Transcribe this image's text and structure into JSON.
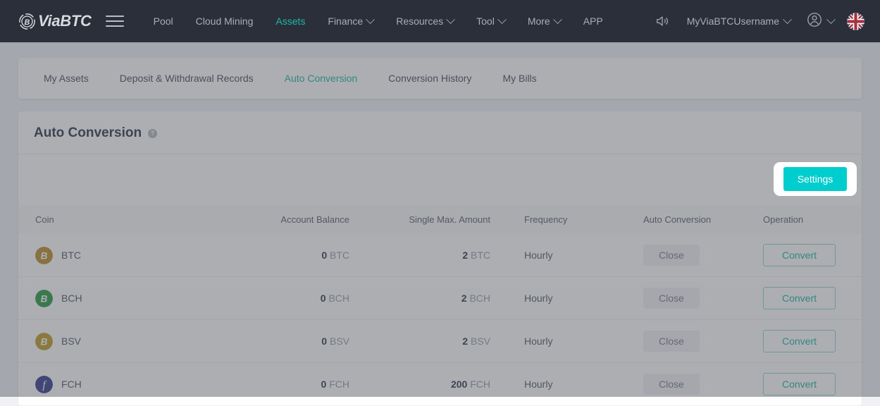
{
  "header": {
    "brand": "ViaBTC",
    "menu_icon": "hamburger-icon",
    "nav": [
      {
        "label": "Pool",
        "dropdown": false,
        "active": false
      },
      {
        "label": "Cloud Mining",
        "dropdown": false,
        "active": false
      },
      {
        "label": "Assets",
        "dropdown": false,
        "active": true
      },
      {
        "label": "Finance",
        "dropdown": true,
        "active": false
      },
      {
        "label": "Resources",
        "dropdown": true,
        "active": false
      },
      {
        "label": "Tool",
        "dropdown": true,
        "active": false
      },
      {
        "label": "More",
        "dropdown": true,
        "active": false
      },
      {
        "label": "APP",
        "dropdown": false,
        "active": false
      }
    ],
    "announcement_icon": "speaker-icon",
    "username": "MyViaBTCUsername",
    "account_icon": "user-circle-icon",
    "language_icon": "uk-flag-icon"
  },
  "tabs": [
    {
      "label": "My Assets",
      "active": false
    },
    {
      "label": "Deposit & Withdrawal Records",
      "active": false
    },
    {
      "label": "Auto Conversion",
      "active": true
    },
    {
      "label": "Conversion History",
      "active": false
    },
    {
      "label": "My Bills",
      "active": false
    }
  ],
  "panel": {
    "title": "Auto Conversion",
    "help_icon": "question-mark-icon",
    "settings_label": "Settings"
  },
  "table": {
    "columns": [
      "Coin",
      "Account Balance",
      "Single Max. Amount",
      "Frequency",
      "Auto Conversion",
      "Operation"
    ],
    "rows": [
      {
        "coin": "BTC",
        "icon_color": "#c08f2e",
        "balance_value": "0",
        "balance_unit": "BTC",
        "max_value": "2",
        "max_unit": "BTC",
        "frequency": "Hourly",
        "auto_conversion": "Close",
        "operation": "Convert"
      },
      {
        "coin": "BCH",
        "icon_color": "#2e9b47",
        "balance_value": "0",
        "balance_unit": "BCH",
        "max_value": "2",
        "max_unit": "BCH",
        "frequency": "Hourly",
        "auto_conversion": "Close",
        "operation": "Convert"
      },
      {
        "coin": "BSV",
        "icon_color": "#c2a02e",
        "balance_value": "0",
        "balance_unit": "BSV",
        "max_value": "2",
        "max_unit": "BSV",
        "frequency": "Hourly",
        "auto_conversion": "Close",
        "operation": "Convert"
      },
      {
        "coin": "FCH",
        "icon_color": "#3b3f8f",
        "balance_value": "0",
        "balance_unit": "FCH",
        "max_value": "200",
        "max_unit": "FCH",
        "frequency": "Hourly",
        "auto_conversion": "Close",
        "operation": "Convert"
      }
    ]
  },
  "colors": {
    "brand_teal": "#1fb8a6",
    "primary_button": "#00cdcd",
    "topbar": "#2b2f3a",
    "page_bg": "#f0f2f5"
  }
}
